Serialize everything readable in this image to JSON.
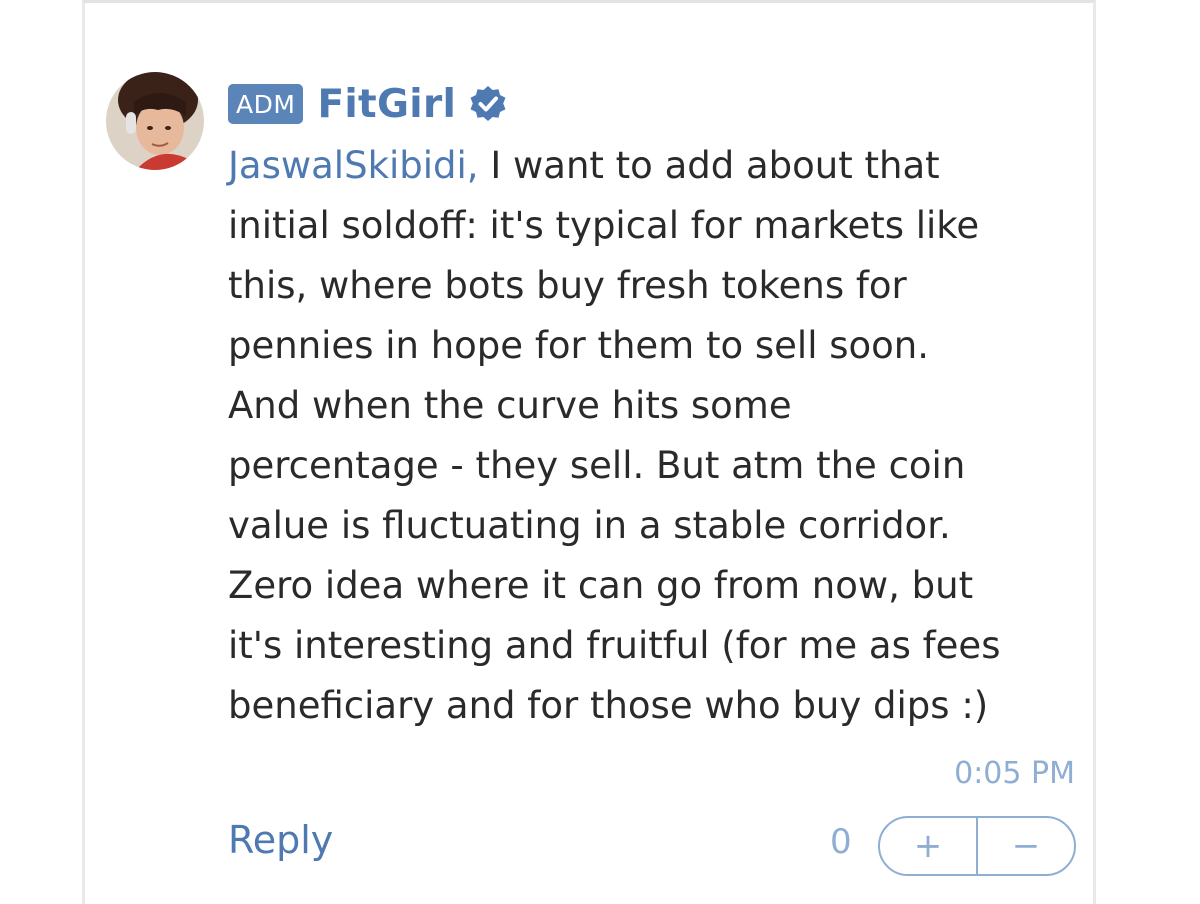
{
  "comment": {
    "badge": "ADM",
    "author": "FitGirl",
    "mention": "JaswalSkibidi,",
    "text": " I want to add about that\ninitial soldoff: it's typical for markets like\nthis, where bots buy fresh tokens for\npennies in hope for them to sell soon.\nAnd when the curve hits some\npercentage - they sell. But atm the coin\nvalue is fluctuating in a stable corridor.\nZero idea where it can go from now, but\nit's interesting and fruitful (for me as fees\nbeneficiary and for those who buy dips :)",
    "time": "0:05 PM"
  },
  "actions": {
    "reply_label": "Reply",
    "score": "0",
    "upvote_label": "+",
    "downvote_label": "−"
  },
  "icons": {
    "verified": "verified-badge-icon",
    "avatar": "user-avatar"
  },
  "colors": {
    "accent": "#4e79b1",
    "badge_bg": "#5b84b9",
    "muted": "#8faed3",
    "text": "#2a2a2a",
    "border": "#e9e9e9"
  }
}
